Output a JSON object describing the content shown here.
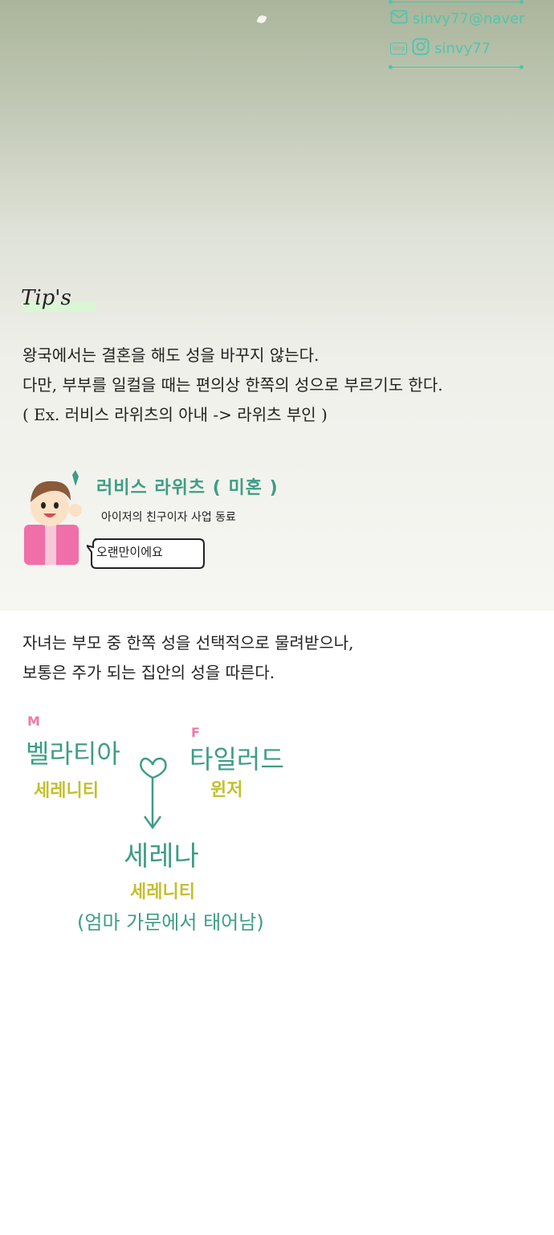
{
  "contact": {
    "email": "sinvy77@naver",
    "blog_tag": "blog",
    "instagram": "sinvy77"
  },
  "tips": {
    "heading": "Tip's",
    "paragraph1": [
      "왕국에서는 결혼을 해도 성을 바꾸지 않는다.",
      "다만, 부부를 일컬을 때는 편의상 한쪽의 성으로 부르기도 한다.",
      "( Ex. 러비스 라위츠의 아내 -> 라위츠 부인 )"
    ],
    "paragraph2": [
      "자녀는 부모 중 한쪽 성을 선택적으로 물려받으나,",
      "보통은 주가 되는 집안의 성을 따른다."
    ]
  },
  "profile": {
    "name": "러비스 라위츠 ( 미혼 )",
    "role": "아이저의 친구이자 사업 동료",
    "speech": "오랜만이에요"
  },
  "family": {
    "mother_tag": "M",
    "mother_name": "벨라티아",
    "mother_surname": "세레니티",
    "father_tag": "F",
    "father_name": "타일러드",
    "father_surname": "윈저",
    "child_name": "세레나",
    "child_surname": "세레니티",
    "child_note": "(엄마 가문에서 태어남)"
  },
  "colors": {
    "accent_teal": "#3e9d84",
    "contact_teal": "#52c5ae",
    "olive": "#c4bf2c",
    "pink": "#f07aa8"
  }
}
